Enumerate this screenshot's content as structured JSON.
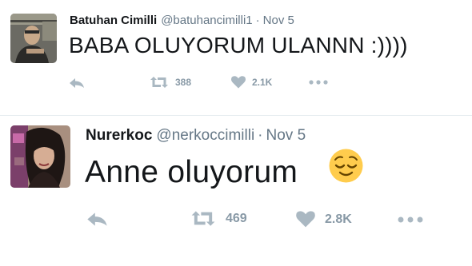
{
  "tweets": [
    {
      "author": "Batuhan Cimilli",
      "handle": "@batuhancimilli1",
      "separator": "·",
      "date": "Nov 5",
      "text": "BABA OLUYORUM ULANNN :))))",
      "retweets": "388",
      "likes": "2.1K",
      "icons": [
        "reply-icon",
        "retweet-icon",
        "heart-icon",
        "more-icon"
      ]
    },
    {
      "author": "Nurerkoc",
      "handle": "@nerkoccimilli",
      "separator": "·",
      "date": "Nov 5",
      "text": "Anne oluyorum",
      "emoji": "relieved-face-emoji",
      "retweets": "469",
      "likes": "2.8K",
      "icons": [
        "reply-icon",
        "retweet-icon",
        "heart-icon",
        "more-icon"
      ]
    }
  ],
  "colors": {
    "name_text": "#14171a",
    "secondary_text": "#657786",
    "action_icon": "#aab8c2",
    "divider": "#e6ecf0"
  }
}
